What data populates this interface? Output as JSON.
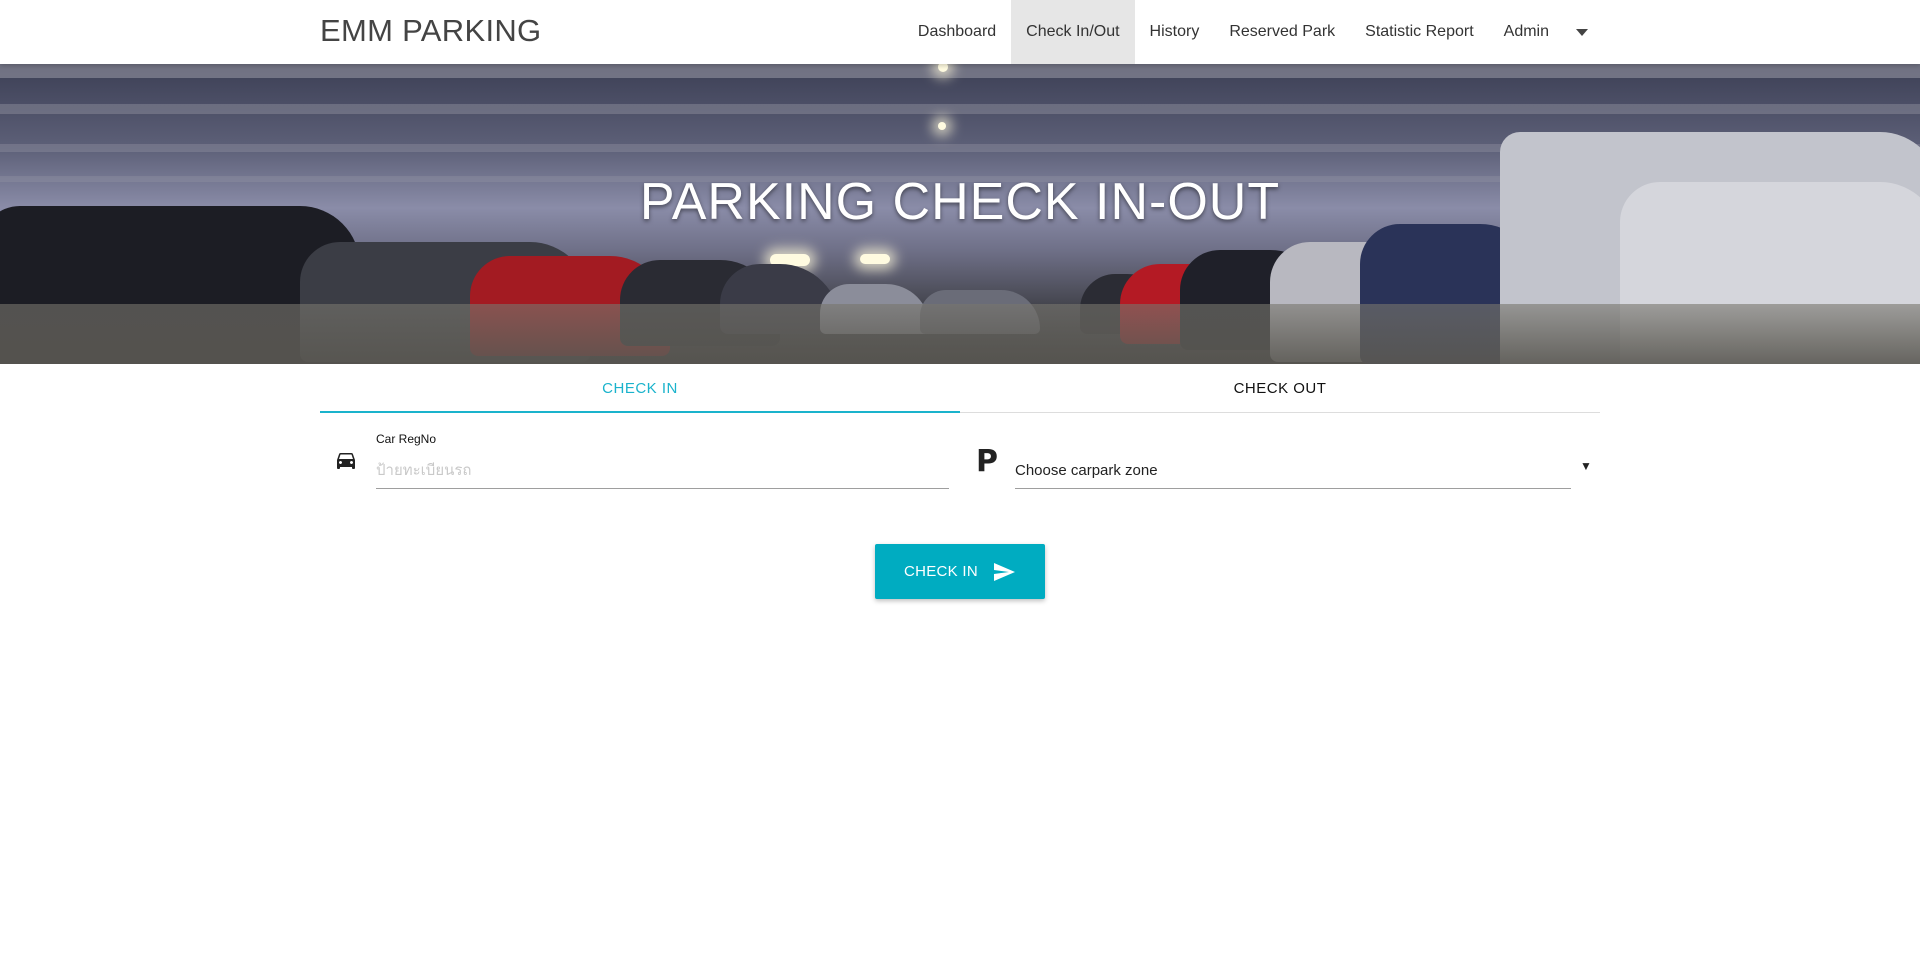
{
  "navbar": {
    "brand": "EMM PARKING",
    "items": [
      {
        "label": "Dashboard",
        "active": false
      },
      {
        "label": "Check In/Out",
        "active": true
      },
      {
        "label": "History",
        "active": false
      },
      {
        "label": "Reserved Park",
        "active": false
      },
      {
        "label": "Statistic Report",
        "active": false
      },
      {
        "label": "Admin",
        "active": false
      }
    ],
    "dropdown_icon": "caret-down-icon"
  },
  "hero": {
    "title": "PARKING CHECK IN-OUT"
  },
  "tabs": [
    {
      "label": "CHECK IN",
      "active": true
    },
    {
      "label": "CHECK OUT",
      "active": false
    }
  ],
  "form": {
    "car_reg": {
      "icon": "car-icon",
      "label": "Car RegNo",
      "value": "",
      "placeholder": "ป้ายทะเบียนรถ"
    },
    "zone": {
      "icon": "parking-icon",
      "icon_glyph": "P",
      "selected": "Choose carpark zone",
      "arrow": "▼"
    },
    "submit": {
      "label": "CHECK IN",
      "icon": "send-icon"
    }
  },
  "colors": {
    "accent": "#00acc1",
    "tab_active": "#1ab3cc",
    "nav_active_bg": "#e6e6e6"
  }
}
